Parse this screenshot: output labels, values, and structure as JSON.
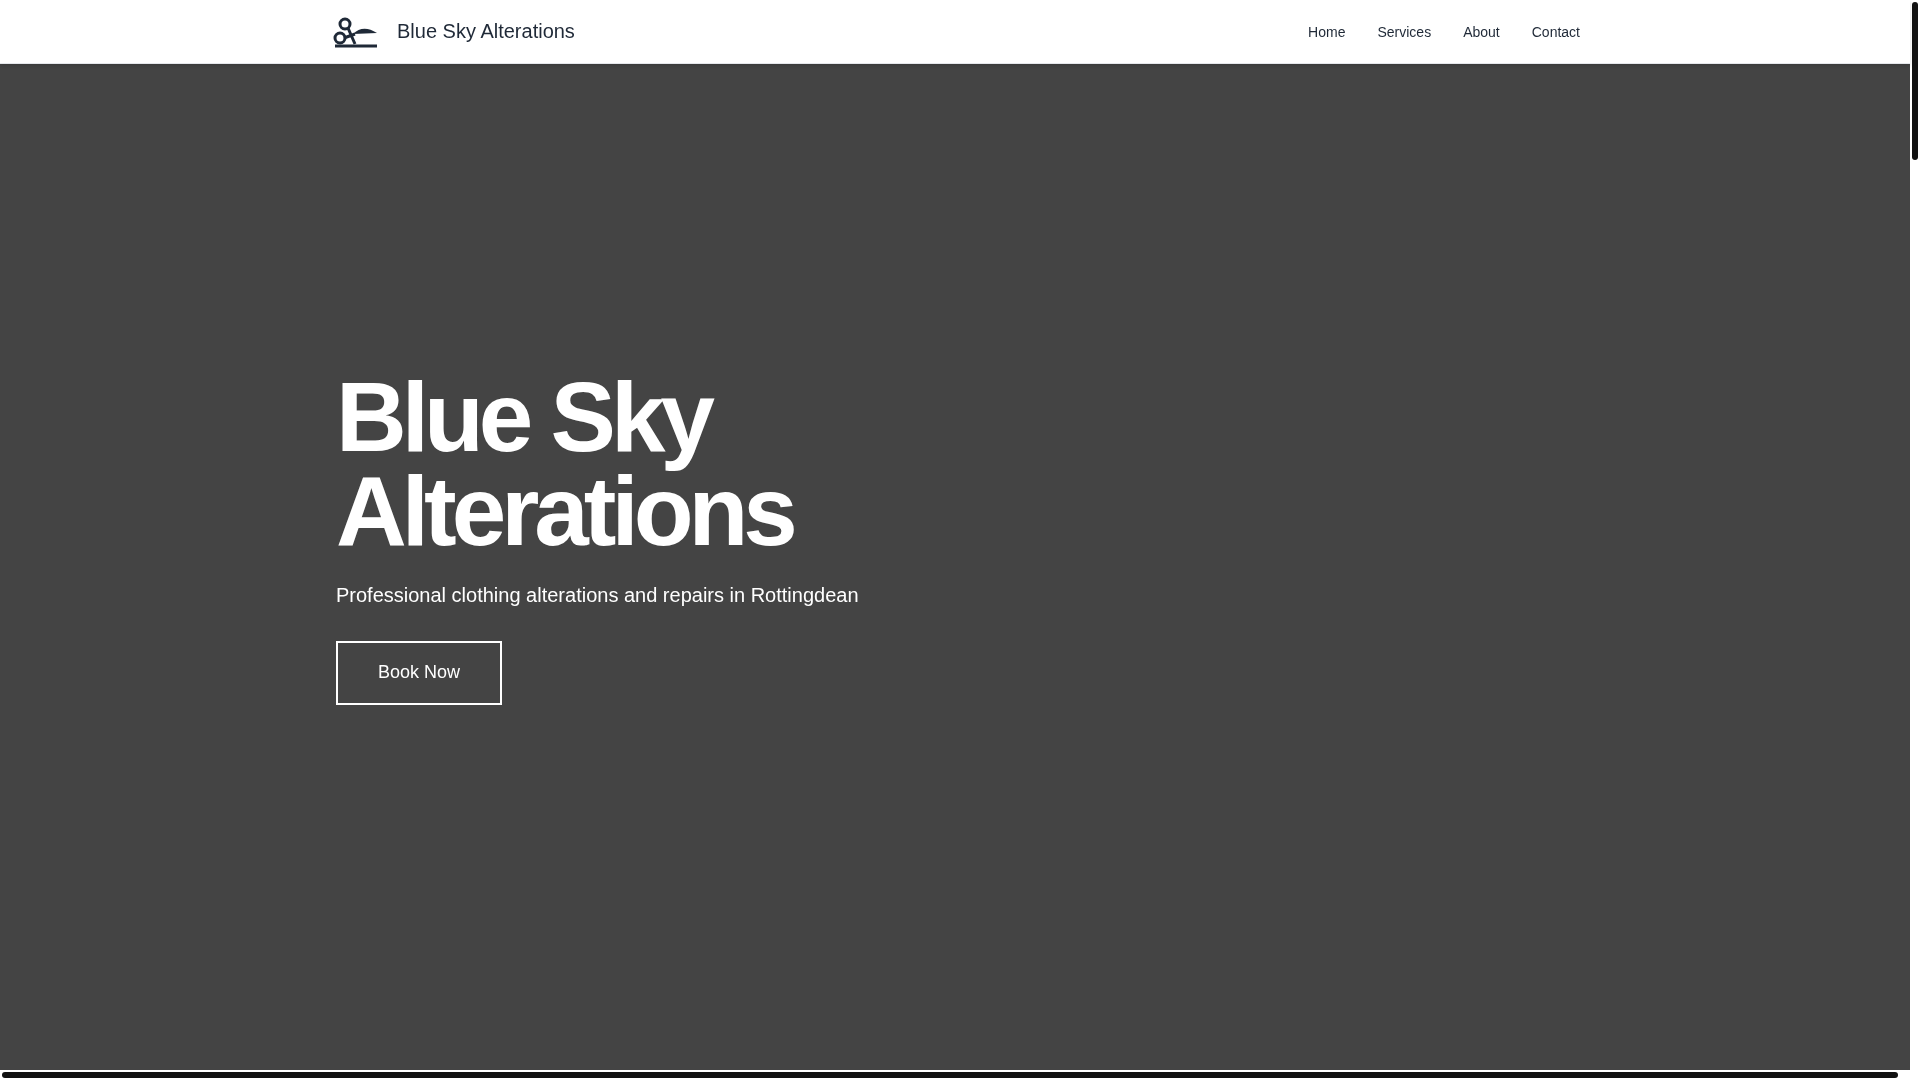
{
  "header": {
    "brand": "Blue Sky Alterations",
    "nav": [
      {
        "label": "Home"
      },
      {
        "label": "Services"
      },
      {
        "label": "About"
      },
      {
        "label": "Contact"
      }
    ]
  },
  "hero": {
    "title_lines": [
      "Blue Sky",
      "Alterations"
    ],
    "subtitle": "Professional clothing alterations and repairs in Rottingdean",
    "button": "Book Now"
  }
}
